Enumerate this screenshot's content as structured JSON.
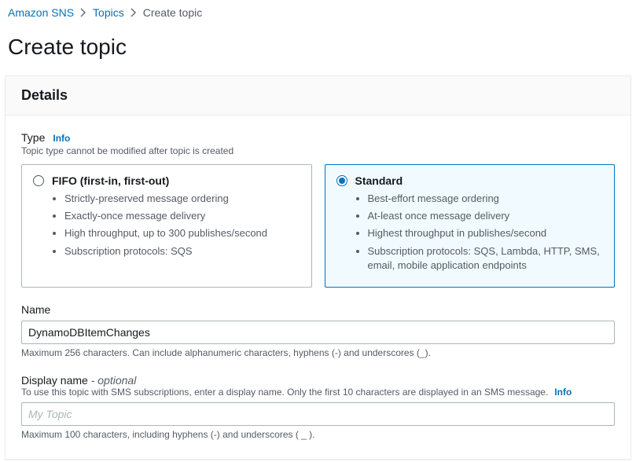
{
  "breadcrumb": {
    "root": "Amazon SNS",
    "level1": "Topics",
    "current": "Create topic"
  },
  "page_title": "Create topic",
  "panel": {
    "header": "Details",
    "type_field": {
      "label": "Type",
      "info": "Info",
      "desc": "Topic type cannot be modified after topic is created",
      "fifo": {
        "title": "FIFO (first-in, first-out)",
        "bullets": [
          "Strictly-preserved message ordering",
          "Exactly-once message delivery",
          "High throughput, up to 300 publishes/second",
          "Subscription protocols: SQS"
        ]
      },
      "standard": {
        "title": "Standard",
        "bullets": [
          "Best-effort message ordering",
          "At-least once message delivery",
          "Highest throughput in publishes/second",
          "Subscription protocols: SQS, Lambda, HTTP, SMS, email, mobile application endpoints"
        ]
      }
    },
    "name_field": {
      "label": "Name",
      "value": "DynamoDBItemChanges",
      "constraint": "Maximum 256 characters. Can include alphanumeric characters, hyphens (-) and underscores (_)."
    },
    "display_name_field": {
      "label": "Display name",
      "optional_suffix": " - optional",
      "desc": "To use this topic with SMS subscriptions, enter a display name. Only the first 10 characters are displayed in an SMS message.",
      "info": "Info",
      "placeholder": "My Topic",
      "value": "",
      "constraint": "Maximum 100 characters, including hyphens (-) and underscores ( _ )."
    }
  }
}
